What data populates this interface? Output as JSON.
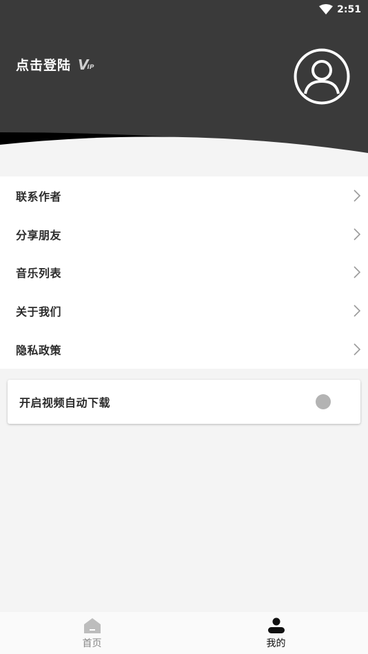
{
  "status_bar": {
    "time": "2:51",
    "wifi_icon": "wifi-icon"
  },
  "header": {
    "login_text": "点击登陆",
    "vip_badge_main": "V",
    "vip_badge_sub": "IP",
    "avatar_icon": "user-circle-icon"
  },
  "menu": {
    "items": [
      {
        "label": "联系作者"
      },
      {
        "label": "分享朋友"
      },
      {
        "label": "音乐列表"
      },
      {
        "label": "关于我们"
      },
      {
        "label": "隐私政策"
      }
    ]
  },
  "settings": {
    "auto_download_label": "开启视频自动下载",
    "auto_download_enabled": false
  },
  "bottom_nav": {
    "home_label": "首页",
    "mine_label": "我的",
    "active": "mine",
    "inactive_color": "#888888",
    "active_color": "#111111"
  },
  "colors": {
    "header_bg": "#3a3a3a",
    "page_bg": "#f4f4f4",
    "toggle_off": "#b3b3b3"
  }
}
